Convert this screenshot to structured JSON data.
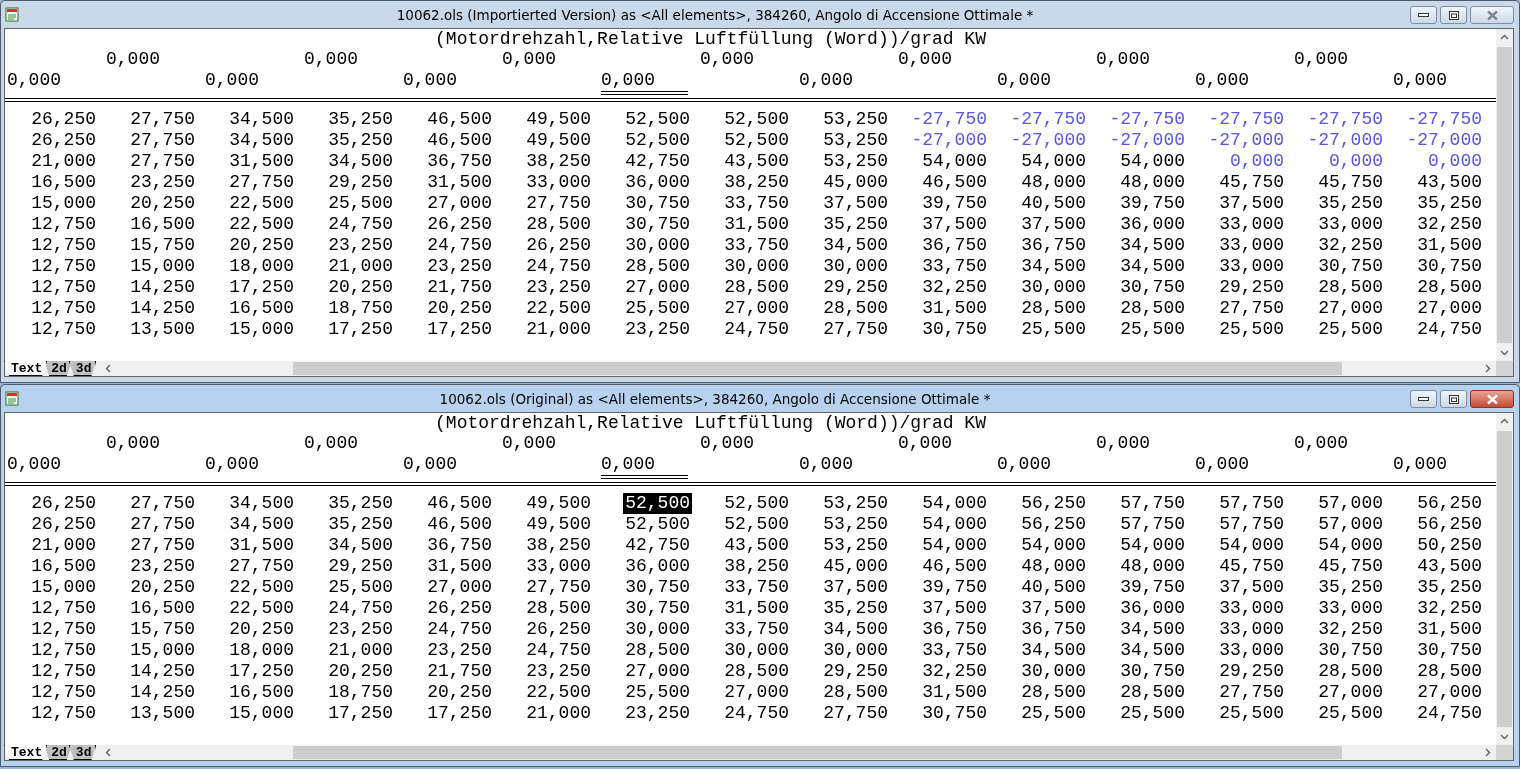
{
  "windows": [
    {
      "title": "10062.ols (Importierted Version) as <All elements>, 384260, Angolo di Accensione Ottimale *",
      "active": false,
      "axis_title": "(Motordrehzahl,Relative Luftfüllung (Word))/grad KW",
      "axis_row_1": [
        "0,000",
        "0,000",
        "0,000",
        "0,000",
        "0,000",
        "0,000",
        "0,000"
      ],
      "axis_row_2": [
        {
          "text": "0,000",
          "selected": false
        },
        {
          "text": "0,000",
          "selected": false
        },
        {
          "text": "0,000",
          "selected": false
        },
        {
          "text": "0,000",
          "selected": true
        },
        {
          "text": "0,000",
          "selected": false
        },
        {
          "text": "0,000",
          "selected": false
        },
        {
          "text": "0,000",
          "selected": false
        },
        {
          "text": "0,000",
          "selected": false
        }
      ],
      "rows": [
        {
          "cells": [
            "26,250",
            "27,750",
            "34,500",
            "35,250",
            "46,500",
            "49,500",
            "52,500",
            "52,500",
            "53,250",
            "-27,750",
            "-27,750",
            "-27,750",
            "-27,750",
            "-27,750",
            "-27,750"
          ],
          "changed": [
            false,
            false,
            false,
            false,
            false,
            false,
            false,
            false,
            false,
            true,
            true,
            true,
            true,
            true,
            true
          ],
          "selected": [
            false,
            false,
            false,
            false,
            false,
            false,
            false,
            false,
            false,
            false,
            false,
            false,
            false,
            false,
            false
          ]
        },
        {
          "cells": [
            "26,250",
            "27,750",
            "34,500",
            "35,250",
            "46,500",
            "49,500",
            "52,500",
            "52,500",
            "53,250",
            "-27,000",
            "-27,000",
            "-27,000",
            "-27,000",
            "-27,000",
            "-27,000"
          ],
          "changed": [
            false,
            false,
            false,
            false,
            false,
            false,
            false,
            false,
            false,
            true,
            true,
            true,
            true,
            true,
            true
          ],
          "selected": [
            false,
            false,
            false,
            false,
            false,
            false,
            false,
            false,
            false,
            false,
            false,
            false,
            false,
            false,
            false
          ]
        },
        {
          "cells": [
            "21,000",
            "27,750",
            "31,500",
            "34,500",
            "36,750",
            "38,250",
            "42,750",
            "43,500",
            "53,250",
            "54,000",
            "54,000",
            "54,000",
            "0,000",
            "0,000",
            "0,000"
          ],
          "changed": [
            false,
            false,
            false,
            false,
            false,
            false,
            false,
            false,
            false,
            false,
            false,
            false,
            true,
            true,
            true
          ],
          "selected": [
            false,
            false,
            false,
            false,
            false,
            false,
            false,
            false,
            false,
            false,
            false,
            false,
            false,
            false,
            false
          ]
        },
        {
          "cells": [
            "16,500",
            "23,250",
            "27,750",
            "29,250",
            "31,500",
            "33,000",
            "36,000",
            "38,250",
            "45,000",
            "46,500",
            "48,000",
            "48,000",
            "45,750",
            "45,750",
            "43,500"
          ],
          "changed": [
            false,
            false,
            false,
            false,
            false,
            false,
            false,
            false,
            false,
            false,
            false,
            false,
            false,
            false,
            false
          ],
          "selected": [
            false,
            false,
            false,
            false,
            false,
            false,
            false,
            false,
            false,
            false,
            false,
            false,
            false,
            false,
            false
          ]
        },
        {
          "cells": [
            "15,000",
            "20,250",
            "22,500",
            "25,500",
            "27,000",
            "27,750",
            "30,750",
            "33,750",
            "37,500",
            "39,750",
            "40,500",
            "39,750",
            "37,500",
            "35,250",
            "35,250"
          ],
          "changed": [
            false,
            false,
            false,
            false,
            false,
            false,
            false,
            false,
            false,
            false,
            false,
            false,
            false,
            false,
            false
          ],
          "selected": [
            false,
            false,
            false,
            false,
            false,
            false,
            false,
            false,
            false,
            false,
            false,
            false,
            false,
            false,
            false
          ]
        },
        {
          "cells": [
            "12,750",
            "16,500",
            "22,500",
            "24,750",
            "26,250",
            "28,500",
            "30,750",
            "31,500",
            "35,250",
            "37,500",
            "37,500",
            "36,000",
            "33,000",
            "33,000",
            "32,250"
          ],
          "changed": [
            false,
            false,
            false,
            false,
            false,
            false,
            false,
            false,
            false,
            false,
            false,
            false,
            false,
            false,
            false
          ],
          "selected": [
            false,
            false,
            false,
            false,
            false,
            false,
            false,
            false,
            false,
            false,
            false,
            false,
            false,
            false,
            false
          ]
        },
        {
          "cells": [
            "12,750",
            "15,750",
            "20,250",
            "23,250",
            "24,750",
            "26,250",
            "30,000",
            "33,750",
            "34,500",
            "36,750",
            "36,750",
            "34,500",
            "33,000",
            "32,250",
            "31,500"
          ],
          "changed": [
            false,
            false,
            false,
            false,
            false,
            false,
            false,
            false,
            false,
            false,
            false,
            false,
            false,
            false,
            false
          ],
          "selected": [
            false,
            false,
            false,
            false,
            false,
            false,
            false,
            false,
            false,
            false,
            false,
            false,
            false,
            false,
            false
          ]
        },
        {
          "cells": [
            "12,750",
            "15,000",
            "18,000",
            "21,000",
            "23,250",
            "24,750",
            "28,500",
            "30,000",
            "30,000",
            "33,750",
            "34,500",
            "34,500",
            "33,000",
            "30,750",
            "30,750"
          ],
          "changed": [
            false,
            false,
            false,
            false,
            false,
            false,
            false,
            false,
            false,
            false,
            false,
            false,
            false,
            false,
            false
          ],
          "selected": [
            false,
            false,
            false,
            false,
            false,
            false,
            false,
            false,
            false,
            false,
            false,
            false,
            false,
            false,
            false
          ]
        },
        {
          "cells": [
            "12,750",
            "14,250",
            "17,250",
            "20,250",
            "21,750",
            "23,250",
            "27,000",
            "28,500",
            "29,250",
            "32,250",
            "30,000",
            "30,750",
            "29,250",
            "28,500",
            "28,500"
          ],
          "changed": [
            false,
            false,
            false,
            false,
            false,
            false,
            false,
            false,
            false,
            false,
            false,
            false,
            false,
            false,
            false
          ],
          "selected": [
            false,
            false,
            false,
            false,
            false,
            false,
            false,
            false,
            false,
            false,
            false,
            false,
            false,
            false,
            false
          ]
        },
        {
          "cells": [
            "12,750",
            "14,250",
            "16,500",
            "18,750",
            "20,250",
            "22,500",
            "25,500",
            "27,000",
            "28,500",
            "31,500",
            "28,500",
            "28,500",
            "27,750",
            "27,000",
            "27,000"
          ],
          "changed": [
            false,
            false,
            false,
            false,
            false,
            false,
            false,
            false,
            false,
            false,
            false,
            false,
            false,
            false,
            false
          ],
          "selected": [
            false,
            false,
            false,
            false,
            false,
            false,
            false,
            false,
            false,
            false,
            false,
            false,
            false,
            false,
            false
          ]
        },
        {
          "cells": [
            "12,750",
            "13,500",
            "15,000",
            "17,250",
            "17,250",
            "21,000",
            "23,250",
            "24,750",
            "27,750",
            "30,750",
            "25,500",
            "25,500",
            "25,500",
            "25,500",
            "24,750"
          ],
          "changed": [
            false,
            false,
            false,
            false,
            false,
            false,
            false,
            false,
            false,
            false,
            false,
            false,
            false,
            false,
            false
          ],
          "selected": [
            false,
            false,
            false,
            false,
            false,
            false,
            false,
            false,
            false,
            false,
            false,
            false,
            false,
            false,
            false
          ]
        }
      ],
      "tabs": [
        {
          "label": "Text",
          "selected": true
        },
        {
          "label": "2d",
          "selected": false
        },
        {
          "label": "3d",
          "selected": false
        }
      ]
    },
    {
      "title": "10062.ols (Original) as <All elements>, 384260, Angolo di Accensione Ottimale *",
      "active": true,
      "axis_title": "(Motordrehzahl,Relative Luftfüllung (Word))/grad KW",
      "axis_row_1": [
        "0,000",
        "0,000",
        "0,000",
        "0,000",
        "0,000",
        "0,000",
        "0,000"
      ],
      "axis_row_2": [
        {
          "text": "0,000",
          "selected": false
        },
        {
          "text": "0,000",
          "selected": false
        },
        {
          "text": "0,000",
          "selected": false
        },
        {
          "text": "0,000",
          "selected": true
        },
        {
          "text": "0,000",
          "selected": false
        },
        {
          "text": "0,000",
          "selected": false
        },
        {
          "text": "0,000",
          "selected": false
        },
        {
          "text": "0,000",
          "selected": false
        }
      ],
      "rows": [
        {
          "cells": [
            "26,250",
            "27,750",
            "34,500",
            "35,250",
            "46,500",
            "49,500",
            "52,500",
            "52,500",
            "53,250",
            "54,000",
            "56,250",
            "57,750",
            "57,750",
            "57,000",
            "56,250"
          ],
          "changed": [
            false,
            false,
            false,
            false,
            false,
            false,
            false,
            false,
            false,
            false,
            false,
            false,
            false,
            false,
            false
          ],
          "selected": [
            false,
            false,
            false,
            false,
            false,
            false,
            true,
            false,
            false,
            false,
            false,
            false,
            false,
            false,
            false
          ]
        },
        {
          "cells": [
            "26,250",
            "27,750",
            "34,500",
            "35,250",
            "46,500",
            "49,500",
            "52,500",
            "52,500",
            "53,250",
            "54,000",
            "56,250",
            "57,750",
            "57,750",
            "57,000",
            "56,250"
          ],
          "changed": [
            false,
            false,
            false,
            false,
            false,
            false,
            false,
            false,
            false,
            false,
            false,
            false,
            false,
            false,
            false
          ],
          "selected": [
            false,
            false,
            false,
            false,
            false,
            false,
            false,
            false,
            false,
            false,
            false,
            false,
            false,
            false,
            false
          ]
        },
        {
          "cells": [
            "21,000",
            "27,750",
            "31,500",
            "34,500",
            "36,750",
            "38,250",
            "42,750",
            "43,500",
            "53,250",
            "54,000",
            "54,000",
            "54,000",
            "54,000",
            "54,000",
            "50,250"
          ],
          "changed": [
            false,
            false,
            false,
            false,
            false,
            false,
            false,
            false,
            false,
            false,
            false,
            false,
            false,
            false,
            false
          ],
          "selected": [
            false,
            false,
            false,
            false,
            false,
            false,
            false,
            false,
            false,
            false,
            false,
            false,
            false,
            false,
            false
          ]
        },
        {
          "cells": [
            "16,500",
            "23,250",
            "27,750",
            "29,250",
            "31,500",
            "33,000",
            "36,000",
            "38,250",
            "45,000",
            "46,500",
            "48,000",
            "48,000",
            "45,750",
            "45,750",
            "43,500"
          ],
          "changed": [
            false,
            false,
            false,
            false,
            false,
            false,
            false,
            false,
            false,
            false,
            false,
            false,
            false,
            false,
            false
          ],
          "selected": [
            false,
            false,
            false,
            false,
            false,
            false,
            false,
            false,
            false,
            false,
            false,
            false,
            false,
            false,
            false
          ]
        },
        {
          "cells": [
            "15,000",
            "20,250",
            "22,500",
            "25,500",
            "27,000",
            "27,750",
            "30,750",
            "33,750",
            "37,500",
            "39,750",
            "40,500",
            "39,750",
            "37,500",
            "35,250",
            "35,250"
          ],
          "changed": [
            false,
            false,
            false,
            false,
            false,
            false,
            false,
            false,
            false,
            false,
            false,
            false,
            false,
            false,
            false
          ],
          "selected": [
            false,
            false,
            false,
            false,
            false,
            false,
            false,
            false,
            false,
            false,
            false,
            false,
            false,
            false,
            false
          ]
        },
        {
          "cells": [
            "12,750",
            "16,500",
            "22,500",
            "24,750",
            "26,250",
            "28,500",
            "30,750",
            "31,500",
            "35,250",
            "37,500",
            "37,500",
            "36,000",
            "33,000",
            "33,000",
            "32,250"
          ],
          "changed": [
            false,
            false,
            false,
            false,
            false,
            false,
            false,
            false,
            false,
            false,
            false,
            false,
            false,
            false,
            false
          ],
          "selected": [
            false,
            false,
            false,
            false,
            false,
            false,
            false,
            false,
            false,
            false,
            false,
            false,
            false,
            false,
            false
          ]
        },
        {
          "cells": [
            "12,750",
            "15,750",
            "20,250",
            "23,250",
            "24,750",
            "26,250",
            "30,000",
            "33,750",
            "34,500",
            "36,750",
            "36,750",
            "34,500",
            "33,000",
            "32,250",
            "31,500"
          ],
          "changed": [
            false,
            false,
            false,
            false,
            false,
            false,
            false,
            false,
            false,
            false,
            false,
            false,
            false,
            false,
            false
          ],
          "selected": [
            false,
            false,
            false,
            false,
            false,
            false,
            false,
            false,
            false,
            false,
            false,
            false,
            false,
            false,
            false
          ]
        },
        {
          "cells": [
            "12,750",
            "15,000",
            "18,000",
            "21,000",
            "23,250",
            "24,750",
            "28,500",
            "30,000",
            "30,000",
            "33,750",
            "34,500",
            "34,500",
            "33,000",
            "30,750",
            "30,750"
          ],
          "changed": [
            false,
            false,
            false,
            false,
            false,
            false,
            false,
            false,
            false,
            false,
            false,
            false,
            false,
            false,
            false
          ],
          "selected": [
            false,
            false,
            false,
            false,
            false,
            false,
            false,
            false,
            false,
            false,
            false,
            false,
            false,
            false,
            false
          ]
        },
        {
          "cells": [
            "12,750",
            "14,250",
            "17,250",
            "20,250",
            "21,750",
            "23,250",
            "27,000",
            "28,500",
            "29,250",
            "32,250",
            "30,000",
            "30,750",
            "29,250",
            "28,500",
            "28,500"
          ],
          "changed": [
            false,
            false,
            false,
            false,
            false,
            false,
            false,
            false,
            false,
            false,
            false,
            false,
            false,
            false,
            false
          ],
          "selected": [
            false,
            false,
            false,
            false,
            false,
            false,
            false,
            false,
            false,
            false,
            false,
            false,
            false,
            false,
            false
          ]
        },
        {
          "cells": [
            "12,750",
            "14,250",
            "16,500",
            "18,750",
            "20,250",
            "22,500",
            "25,500",
            "27,000",
            "28,500",
            "31,500",
            "28,500",
            "28,500",
            "27,750",
            "27,000",
            "27,000"
          ],
          "changed": [
            false,
            false,
            false,
            false,
            false,
            false,
            false,
            false,
            false,
            false,
            false,
            false,
            false,
            false,
            false
          ],
          "selected": [
            false,
            false,
            false,
            false,
            false,
            false,
            false,
            false,
            false,
            false,
            false,
            false,
            false,
            false,
            false
          ]
        },
        {
          "cells": [
            "12,750",
            "13,500",
            "15,000",
            "17,250",
            "17,250",
            "21,000",
            "23,250",
            "24,750",
            "27,750",
            "30,750",
            "25,500",
            "25,500",
            "25,500",
            "25,500",
            "24,750"
          ],
          "changed": [
            false,
            false,
            false,
            false,
            false,
            false,
            false,
            false,
            false,
            false,
            false,
            false,
            false,
            false,
            false
          ],
          "selected": [
            false,
            false,
            false,
            false,
            false,
            false,
            false,
            false,
            false,
            false,
            false,
            false,
            false,
            false,
            false
          ]
        }
      ],
      "tabs": [
        {
          "label": "Text",
          "selected": true
        },
        {
          "label": "2d",
          "selected": false
        },
        {
          "label": "3d",
          "selected": false
        }
      ]
    }
  ]
}
